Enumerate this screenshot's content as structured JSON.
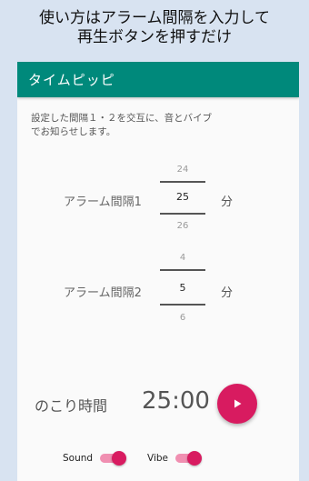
{
  "caption": {
    "line1": "使い方はアラーム間隔を入力して",
    "line2": "再生ボタンを押すだけ"
  },
  "app": {
    "title": "タイムピッピ",
    "accent_color": "#00897b",
    "button_color": "#d81b60"
  },
  "description": {
    "line1": "設定した間隔１・２を交互に、音とバイブ",
    "line2": "でお知らせします。"
  },
  "alarm1": {
    "label": "アラーム間隔1",
    "prev": "24",
    "value": "25",
    "next": "26",
    "unit": "分"
  },
  "alarm2": {
    "label": "アラーム間隔2",
    "prev": "4",
    "value": "5",
    "next": "6",
    "unit": "分"
  },
  "remaining": {
    "label": "のこり時間",
    "time": "25:00"
  },
  "play_button": {
    "icon": "play-icon"
  },
  "toggles": {
    "sound": {
      "label": "Sound",
      "on": true
    },
    "vibe": {
      "label": "Vibe",
      "on": true
    }
  }
}
